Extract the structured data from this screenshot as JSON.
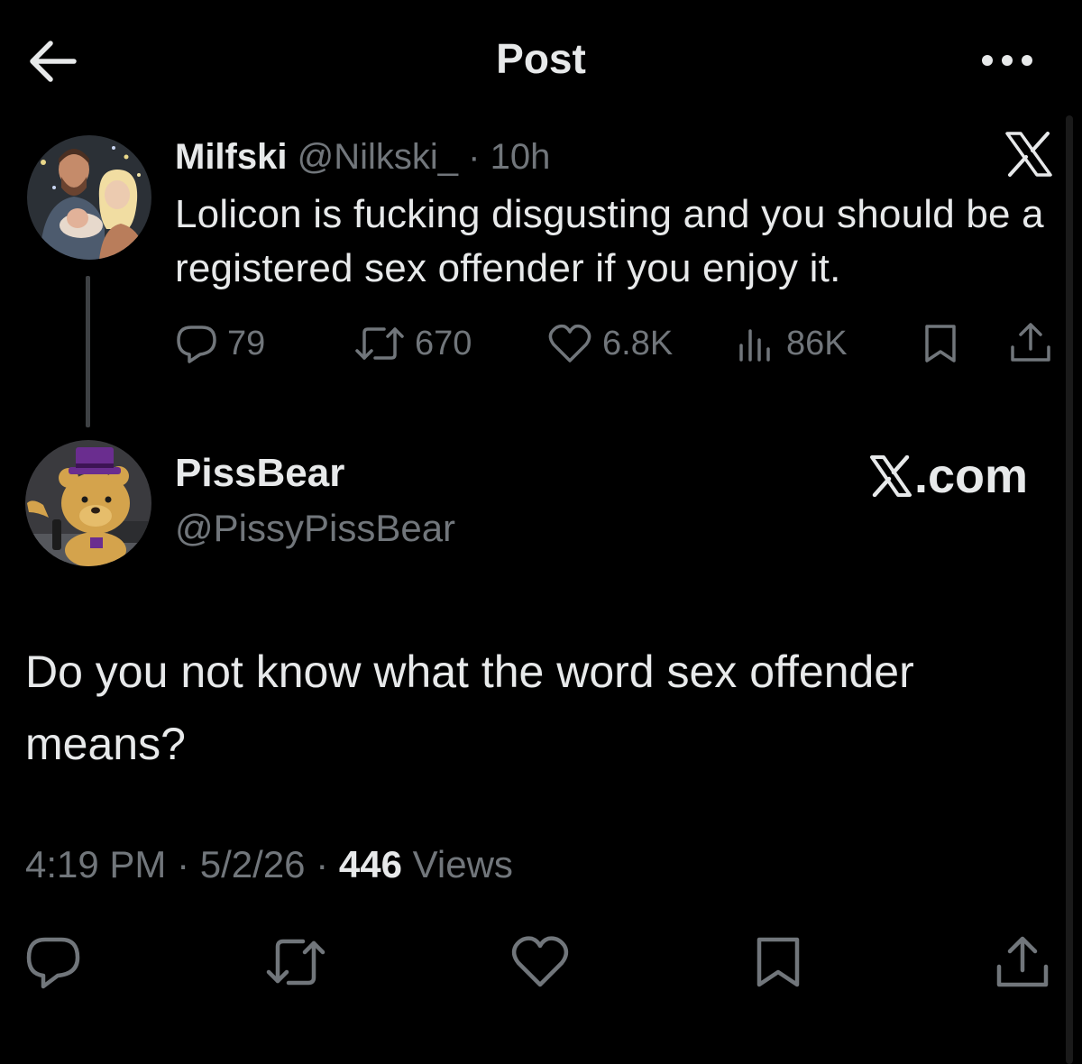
{
  "header": {
    "title": "Post",
    "back_icon": "arrow-left-icon",
    "more_icon": "more-horizontal-icon"
  },
  "quoted_post": {
    "display_name": "Milfski",
    "handle": "@Nilkski_",
    "separator": "·",
    "time": "10h",
    "text": "Lolicon is fucking disgusting and you should be a registered sex offender if you enjoy it.",
    "metrics": {
      "replies": "79",
      "reposts": "670",
      "likes": "6.8K",
      "views": "86K"
    }
  },
  "main_post": {
    "display_name": "PissBear",
    "handle": "@PissyPissBear",
    "brand": ".com",
    "text": "Do you not know what the word sex offender means?",
    "time": "4:19 PM",
    "sep1": "·",
    "date": "5/2/26",
    "sep2": "·",
    "views_count": "446",
    "views_label": "Views"
  },
  "colors": {
    "background": "#000000",
    "text_primary": "#e7e9ea",
    "text_secondary": "#71767b",
    "thread_line": "#3e4144"
  }
}
